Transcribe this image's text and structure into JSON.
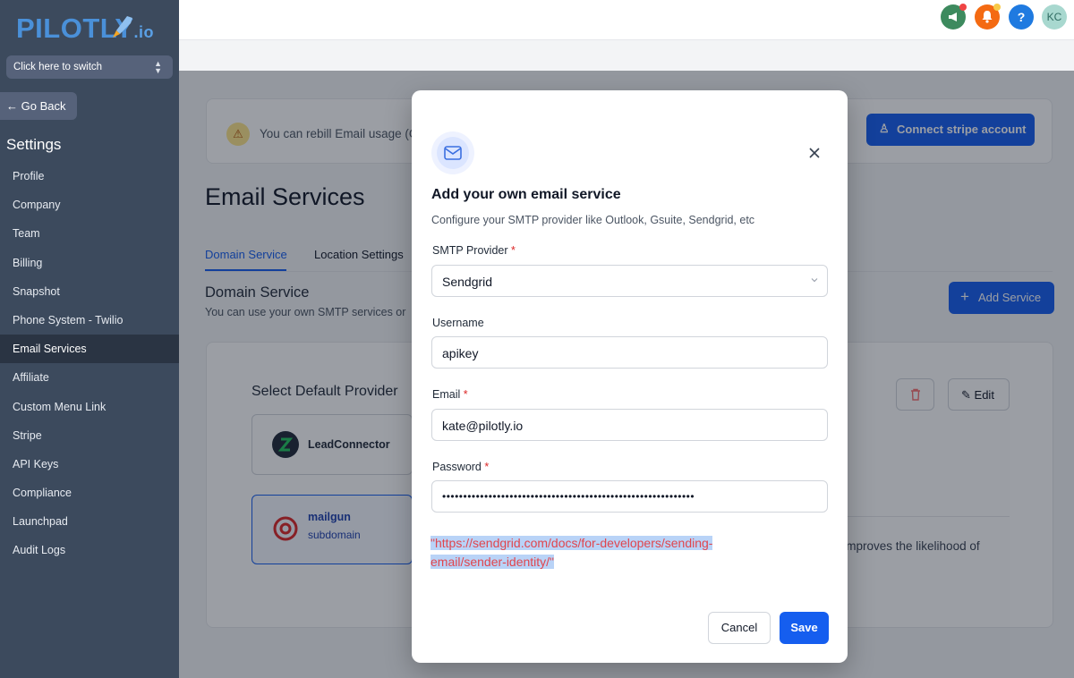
{
  "brand": {
    "name": "PILOTLY",
    "suffix": ".io"
  },
  "sidebar": {
    "switcher_label": "Click here to switch",
    "go_back_label": "Go Back",
    "section_title": "Settings",
    "items": [
      {
        "label": "Profile"
      },
      {
        "label": "Company"
      },
      {
        "label": "Team"
      },
      {
        "label": "Billing"
      },
      {
        "label": "Snapshot"
      },
      {
        "label": "Phone System - Twilio"
      },
      {
        "label": "Email Services"
      },
      {
        "label": "Affiliate"
      },
      {
        "label": "Custom Menu Link"
      },
      {
        "label": "Stripe"
      },
      {
        "label": "API Keys"
      },
      {
        "label": "Compliance"
      },
      {
        "label": "Launchpad"
      },
      {
        "label": "Audit Logs"
      }
    ],
    "active_item": "Email Services"
  },
  "topbar": {
    "help_label": "?",
    "avatar_initials": "KC",
    "colors": {
      "announce": "#3d8a5e",
      "notifications": "#f46a12",
      "help": "#1f7ae0",
      "avatar": "#a8d8cf"
    }
  },
  "main": {
    "banner_text": "You can rebill Email usage (O",
    "connect_button": "Connect stripe account",
    "page_title": "Email Services",
    "tabs": [
      {
        "label": "Domain Service"
      },
      {
        "label": "Location Settings"
      }
    ],
    "section_title": "Domain Service",
    "section_sub": "You can use your own SMTP services or",
    "add_service_button": "Add Service",
    "card": {
      "select_default_title": "Select Default Provider",
      "providers": [
        {
          "name": "LeadConnector"
        },
        {
          "name": "mailgun",
          "sub": "subdomain"
        }
      ],
      "edit_button": "Edit",
      "body_text": "n improves the likelihood of"
    }
  },
  "modal": {
    "title": "Add your own email service",
    "subtitle": "Configure your SMTP provider like Outlook, Gsuite, Sendgrid, etc",
    "fields": {
      "smtp_provider": {
        "label": "SMTP Provider",
        "value": "Sendgrid"
      },
      "username": {
        "label": "Username",
        "value": "apikey"
      },
      "email": {
        "label": "Email",
        "value": "kate@pilotly.io"
      },
      "password": {
        "label": "Password",
        "value": "••••••••••••••••••••••••••••••••••••••••••••••••••••••••••••"
      }
    },
    "required_mark": "*",
    "link_line1": "\"https://sendgrid.com/docs/for-developers/sending-",
    "link_line2": "email/sender-identity/\"",
    "cancel_button": "Cancel",
    "save_button": "Save",
    "accent": "#155eef"
  }
}
